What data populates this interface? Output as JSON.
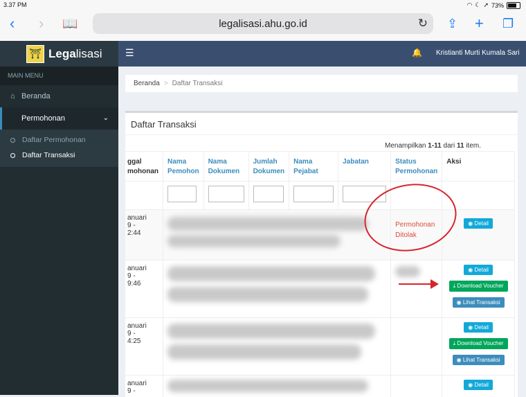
{
  "status_bar": {
    "time": "3.37 PM",
    "battery": "73%"
  },
  "browser": {
    "url": "legalisasi.ahu.go.id"
  },
  "app": {
    "logo_bold": "Lega",
    "logo_rest": "lisasi"
  },
  "sidebar": {
    "main_menu": "MAIN MENU",
    "items": [
      {
        "label": "Beranda"
      },
      {
        "label": "Permohonan"
      }
    ],
    "subitems": [
      {
        "label": "Daftar Permohonan"
      },
      {
        "label": "Daftar Transaksi"
      }
    ]
  },
  "navbar": {
    "user": "Kristianti Murti Kumala Sari"
  },
  "breadcrumb": {
    "home": "Beranda",
    "current": "Daftar Transaksi"
  },
  "panel": {
    "title": "Daftar Transaksi",
    "summary_prefix": "Menampilkan ",
    "summary_range": "1-11",
    "summary_mid": " dari ",
    "summary_total": "11",
    "summary_suffix": " item."
  },
  "table": {
    "headers": [
      {
        "l1": "ggal",
        "l2": "mohonan"
      },
      {
        "l1": "Nama",
        "l2": "Pemohon"
      },
      {
        "l1": "Nama",
        "l2": "Dokumen"
      },
      {
        "l1": "Jumlah",
        "l2": "Dokumen"
      },
      {
        "l1": "Nama",
        "l2": "Pejabat"
      },
      {
        "l1": "Jabatan",
        "l2": ""
      },
      {
        "l1": "Status",
        "l2": "Permohonan"
      },
      {
        "l1": "Aksi",
        "l2": ""
      }
    ],
    "rows": [
      {
        "date_l1": "anuari",
        "date_l2": "9 -",
        "date_l3": "2:44",
        "status_l1": "Permohonan",
        "status_l2": "Ditolak"
      },
      {
        "date_l1": "anuari",
        "date_l2": "9 -",
        "date_l3": "9:46"
      },
      {
        "date_l1": "anuari",
        "date_l2": "9 -",
        "date_l3": "4:25"
      },
      {
        "date_l1": "anuari",
        "date_l2": "9 -"
      }
    ],
    "buttons": {
      "detail": "Detail",
      "download": "Download Voucher",
      "lihat": "Lihat Transaksi"
    }
  },
  "colors": {
    "annotation": "#d8242c",
    "sidebar": "#222d32",
    "navbar": "#3a4f70"
  }
}
